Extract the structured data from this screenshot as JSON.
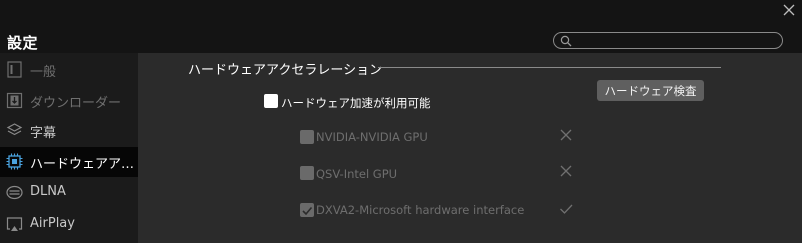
{
  "window": {
    "title": "設定",
    "search": {
      "value": "",
      "placeholder": ""
    }
  },
  "sidebar": {
    "items": [
      {
        "label": "一般",
        "icon": "general-icon"
      },
      {
        "label": "ダウンローダー",
        "icon": "downloader-icon"
      },
      {
        "label": "字幕",
        "icon": "subtitles-icon"
      },
      {
        "label": "ハードウェアア…",
        "icon": "chip-icon",
        "active": true
      },
      {
        "label": "DLNA",
        "icon": "dlna-icon"
      },
      {
        "label": "AirPlay",
        "icon": "airplay-icon"
      }
    ]
  },
  "content": {
    "section_title": "ハードウェアアクセラレーション",
    "check_button": "ハードウェア検査",
    "hw_accel": {
      "label": "ハードウェア加速が利用可能",
      "checked": false
    },
    "options": [
      {
        "label": "NVIDIA-NVIDIA GPU",
        "checked": false,
        "status": "cross"
      },
      {
        "label": "QSV-Intel GPU",
        "checked": false,
        "status": "cross"
      },
      {
        "label": "DXVA2-Microsoft hardware interface",
        "checked": true,
        "status": "check"
      }
    ]
  },
  "colors": {
    "background": "#141414",
    "sidebar": "#1b1b1b",
    "panel": "#2b2b2b",
    "button": "#5f5f5f",
    "active_icon": "#4aa3df"
  }
}
